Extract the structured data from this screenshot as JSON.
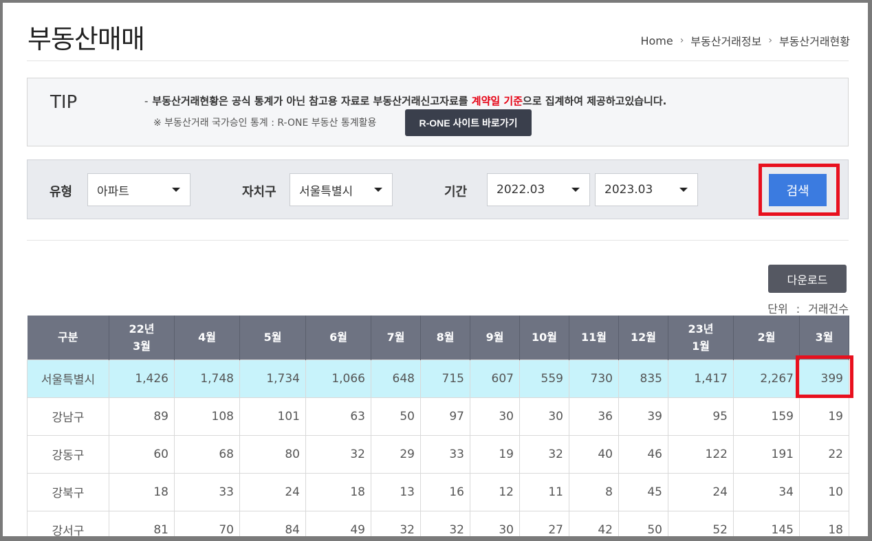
{
  "page": {
    "title": "부동산매매",
    "breadcrumb": [
      "Home",
      "부동산거래정보",
      "부동산거래현황"
    ]
  },
  "tip": {
    "label": "TIP",
    "dash": "-",
    "line1_before": "부동산거래현황은 공식 통계가 아닌 참고용 자료로 부동산거래신고자료를 ",
    "line1_highlight": "계약일 기준",
    "line1_after": "으로 집계하여 제공하고있습니다.",
    "line2": "※ 부동산거래 국가승인 통계 : R-ONE 부동산 통계활용",
    "rone_button": "R-ONE 사이트 바로가기"
  },
  "filters": {
    "type_label": "유형",
    "type_value": "아파트",
    "district_label": "자치구",
    "district_value": "서울특별시",
    "period_label": "기간",
    "period_from": "2022.03",
    "period_to": "2023.03",
    "search_button": "검색"
  },
  "download_button": "다운로드",
  "unit": {
    "label": "단위",
    "colon": ":",
    "value": "거래건수"
  },
  "table": {
    "headers": [
      "구분",
      "22년\n3월",
      "4월",
      "5월",
      "6월",
      "7월",
      "8월",
      "9월",
      "10월",
      "11월",
      "12월",
      "23년\n1월",
      "2월",
      "3월"
    ],
    "rows": [
      {
        "name": "서울특별시",
        "values": [
          "1,426",
          "1,748",
          "1,734",
          "1,066",
          "648",
          "715",
          "607",
          "559",
          "730",
          "835",
          "1,417",
          "2,267",
          "399"
        ]
      },
      {
        "name": "강남구",
        "values": [
          "89",
          "108",
          "101",
          "63",
          "50",
          "97",
          "30",
          "30",
          "36",
          "39",
          "95",
          "159",
          "19"
        ]
      },
      {
        "name": "강동구",
        "values": [
          "60",
          "68",
          "80",
          "32",
          "29",
          "33",
          "19",
          "32",
          "40",
          "46",
          "122",
          "191",
          "22"
        ]
      },
      {
        "name": "강북구",
        "values": [
          "18",
          "33",
          "24",
          "18",
          "13",
          "16",
          "12",
          "11",
          "8",
          "45",
          "24",
          "34",
          "10"
        ]
      },
      {
        "name": "강서구",
        "values": [
          "81",
          "70",
          "84",
          "49",
          "32",
          "32",
          "30",
          "27",
          "42",
          "50",
          "52",
          "145",
          "18"
        ]
      }
    ]
  },
  "colors": {
    "header_bg": "#6e7382",
    "total_row_bg": "#c8f3fb",
    "search_button": "#3b7be0",
    "highlight": "#e8101e",
    "tip_highlight": "#e60012"
  }
}
